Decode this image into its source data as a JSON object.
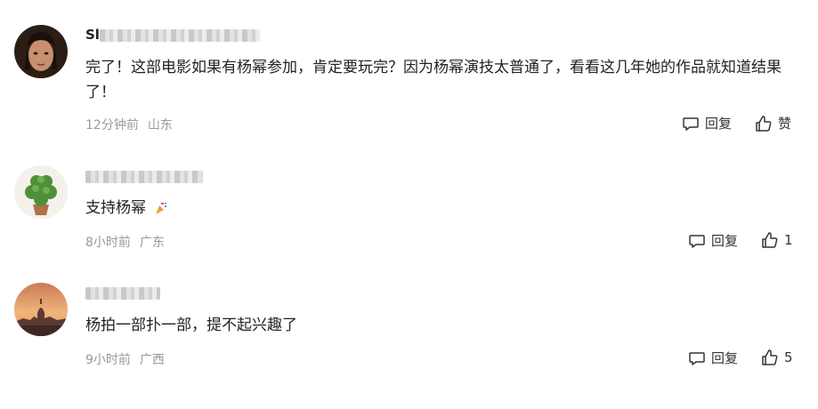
{
  "comments": [
    {
      "user_name": "Sl",
      "avatar": "man-portrait-avatar",
      "text": "完了！这部电影如果有杨幂参加，肯定要玩完？因为杨幂演技太普通了，看看这几年她的作品就知道结果了！",
      "time": "12分钟前",
      "location": "山东",
      "reply_label": "回复",
      "like_label": "赞"
    },
    {
      "user_name": "",
      "avatar": "potted-plant-avatar",
      "text": "支持杨幂",
      "emoji": "party-popper-icon",
      "time": "8小时前",
      "location": "广东",
      "reply_label": "回复",
      "like_label": "1"
    },
    {
      "user_name": "",
      "avatar": "sunset-cityscape-avatar",
      "text": "杨拍一部扑一部，提不起兴趣了",
      "time": "9小时前",
      "location": "广西",
      "reply_label": "回复",
      "like_label": "5"
    }
  ],
  "icons": {
    "reply": "comment-bubble-icon",
    "like": "thumbs-up-icon"
  },
  "colors": {
    "text": "#222222",
    "meta": "#9a9a9a",
    "background": "#ffffff"
  }
}
